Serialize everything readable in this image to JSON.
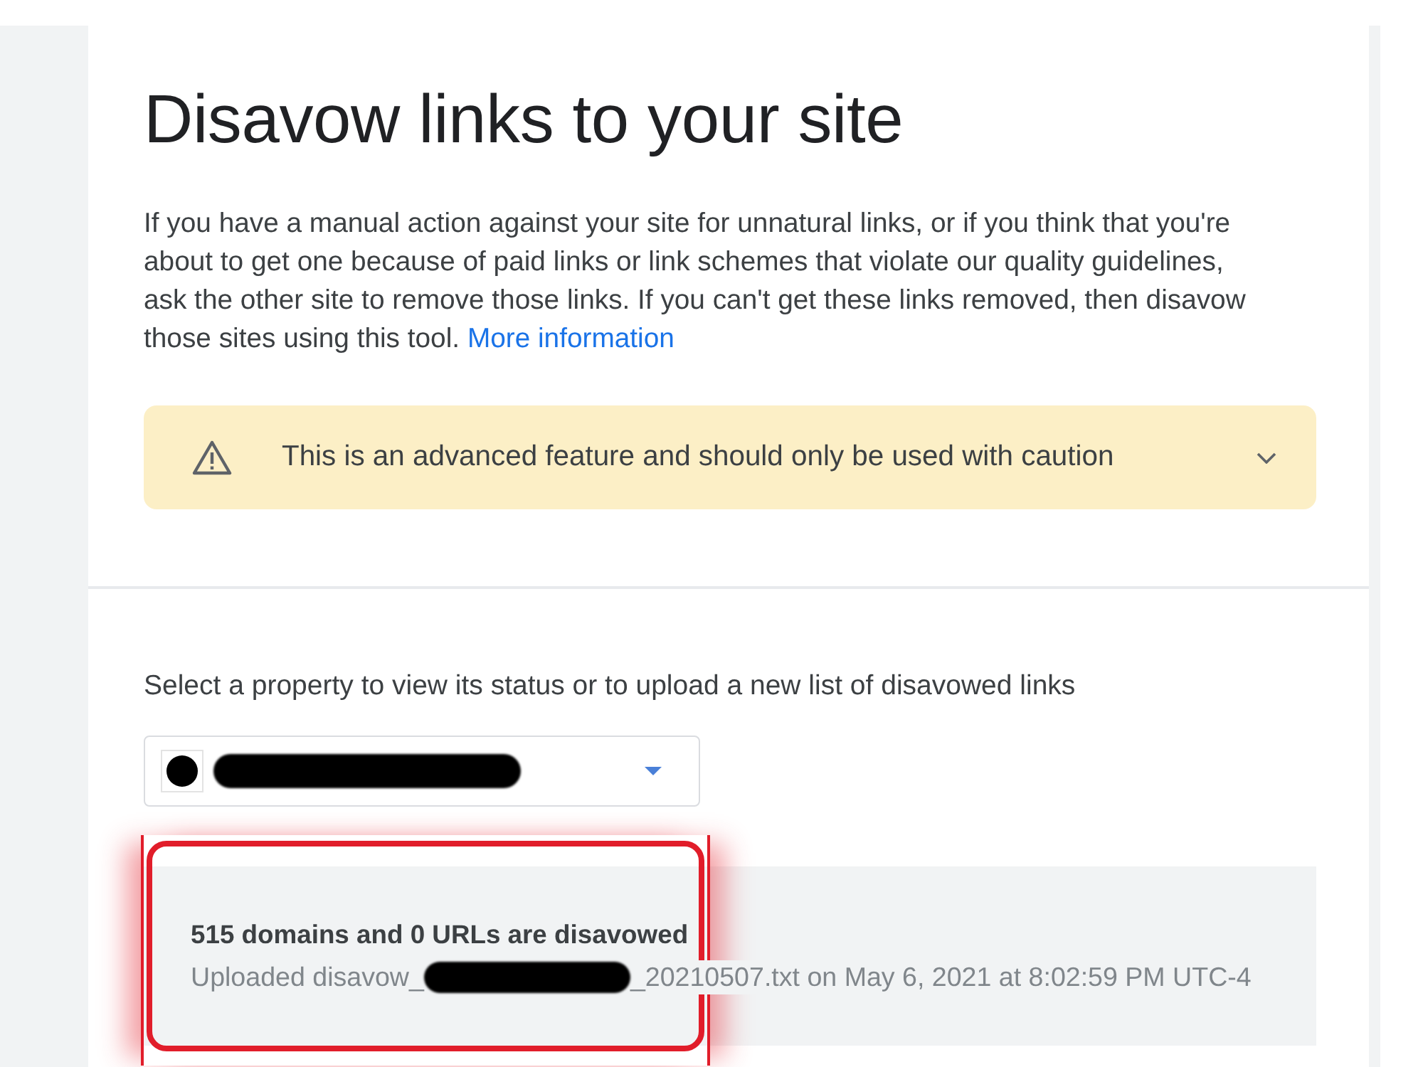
{
  "page": {
    "title": "Disavow links to your site",
    "intro": {
      "text": "If you have a manual action against your site for unnatural links, or if you think that you're about to get one because of paid links or link schemes that violate our quality guidelines, ask the other site to remove those links. If you can't get these links removed, then disavow those sites using this tool.",
      "link": "More information"
    },
    "warning": {
      "text": "This is an advanced feature and should only be used with caution",
      "expanded": false
    }
  },
  "property": {
    "prompt": "Select a property to view its status or to upload a new list of disavowed links",
    "selector": {
      "redacted": true
    }
  },
  "status": {
    "summary": "515 domains and 0 URLs are disavowed",
    "file_prefix": "Uploaded disavow_",
    "file_redacted": true,
    "file_suffix": "_20210507.txt on May 6, 2021 at 8:02:59 PM UTC-4",
    "highlighted": true
  }
}
